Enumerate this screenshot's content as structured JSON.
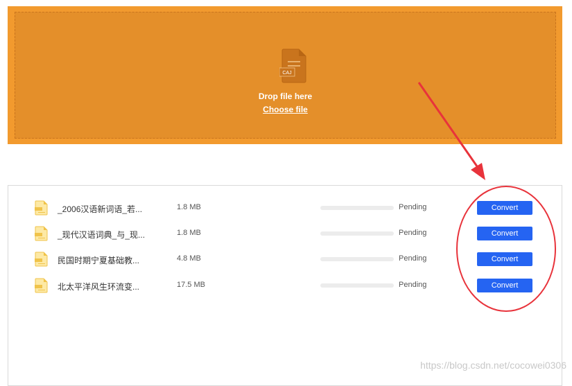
{
  "dropzone": {
    "title": "Drop file here",
    "choose_label": "Choose file",
    "icon_text": "CAJ",
    "icon": "caj-file-icon"
  },
  "files": [
    {
      "name": "_2006汉语新词语_若...",
      "size": "1.8 MB",
      "status": "Pending",
      "progress": 0,
      "button": "Convert"
    },
    {
      "name": "_现代汉语词典_与_现...",
      "size": "1.8 MB",
      "status": "Pending",
      "progress": 0,
      "button": "Convert"
    },
    {
      "name": "民国时期宁夏基础教...",
      "size": "4.8 MB",
      "status": "Pending",
      "progress": 0,
      "button": "Convert"
    },
    {
      "name": "北太平洋风生环流变...",
      "size": "17.5 MB",
      "status": "Pending",
      "progress": 0,
      "button": "Convert"
    }
  ],
  "watermark": "https://blog.csdn.net/cocowei0306",
  "colors": {
    "dropzone_outer": "#f29a2e",
    "dropzone_inner": "#e48f2a",
    "button": "#2564f2",
    "annotation": "#e8333b"
  }
}
